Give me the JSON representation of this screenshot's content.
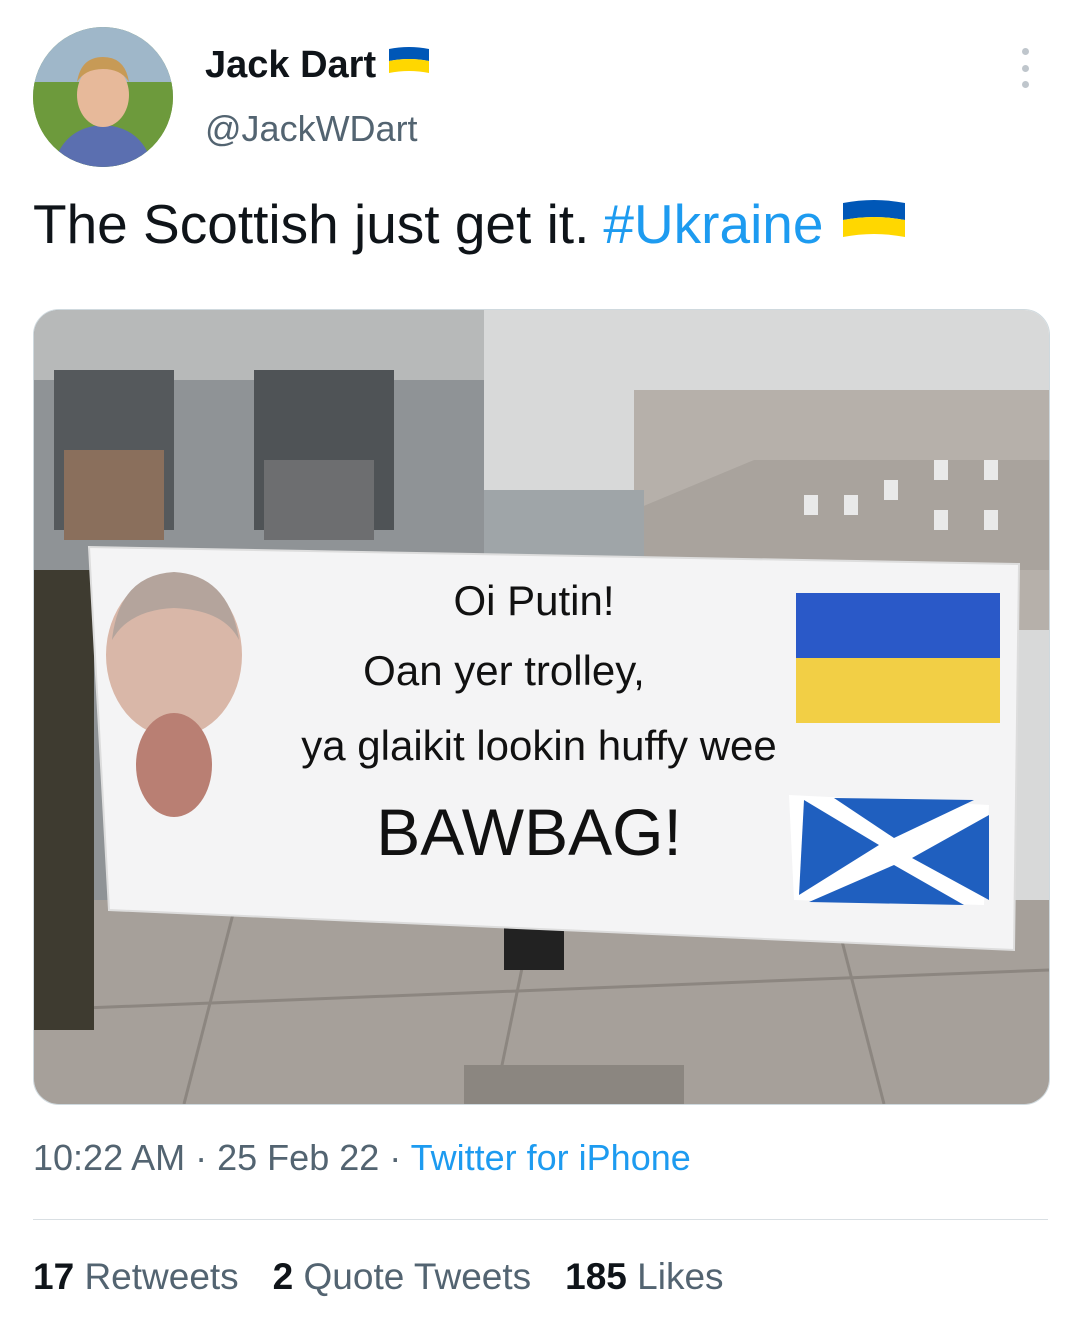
{
  "author": {
    "name": "Jack Dart",
    "handle": "@JackWDart"
  },
  "tweet": {
    "text": "The Scottish just get it.",
    "hashtag": "#Ukraine"
  },
  "media": {
    "banner_line1": "Oi Putin!",
    "banner_line2": "Oan yer trolley,",
    "banner_line3": "ya glaikit lookin huffy wee",
    "banner_line4": "BAWBAG!"
  },
  "meta": {
    "time": "10:22 AM",
    "date": "25 Feb 22",
    "source": "Twitter for iPhone",
    "sep": "·"
  },
  "stats": {
    "retweets_count": "17",
    "retweets_label": "Retweets",
    "quotes_count": "2",
    "quotes_label": "Quote Tweets",
    "likes_count": "185",
    "likes_label": "Likes"
  },
  "colors": {
    "ukraine_blue": "#0057b7",
    "ukraine_yellow": "#ffd700",
    "link_blue": "#1d9bf0",
    "saltire_blue": "#1f5fbf"
  },
  "icons": {
    "more": "more-options-icon",
    "flag": "ukraine-flag-icon"
  }
}
